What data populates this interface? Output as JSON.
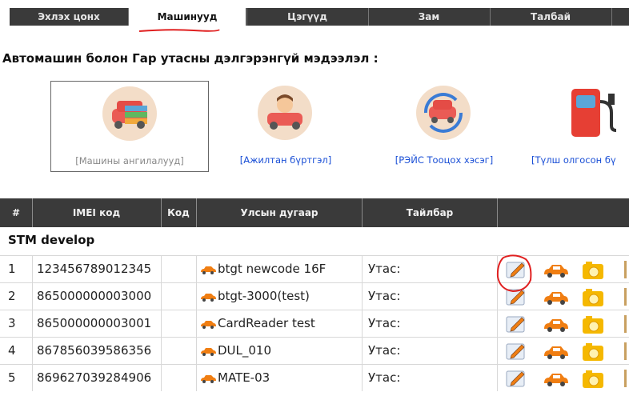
{
  "nav": {
    "tabs": [
      {
        "label": "Эхлэх цонх"
      },
      {
        "label": "Машинууд"
      },
      {
        "label": "Цэгүүд"
      },
      {
        "label": "Зам"
      },
      {
        "label": "Талбай"
      }
    ],
    "active_tab": "Машинууд"
  },
  "page": {
    "title": "Автомашин болон Гар утасны дэлгэрэнгүй мэдээлэл :"
  },
  "cards": [
    {
      "label": "[Машины ангилалууд]",
      "icon": "car-classes-icon"
    },
    {
      "label": "[Ажилтан бүртгэл]",
      "icon": "driver-icon"
    },
    {
      "label": "[РЭЙС Тооцох хэсэг]",
      "icon": "car-cycle-icon"
    },
    {
      "label": "[Түлш олгосон бү",
      "icon": "fuel-pump-icon"
    }
  ],
  "table": {
    "headers": [
      "#",
      "IMEI код",
      "Код",
      "Улсын дугаар",
      "Тайлбар",
      ""
    ],
    "group": "STM develop",
    "rows": [
      {
        "num": "1",
        "imei": "123456789012345",
        "code": "",
        "plate": "btgt newcode 16F",
        "note": "Утас:"
      },
      {
        "num": "2",
        "imei": "865000000003000",
        "code": "",
        "plate": "btgt-3000(test)",
        "note": "Утас:"
      },
      {
        "num": "3",
        "imei": "865000000003001",
        "code": "",
        "plate": "CardReader test",
        "note": "Утас:"
      },
      {
        "num": "4",
        "imei": "867856039586356",
        "code": "",
        "plate": "DUL_010",
        "note": "Утас:"
      },
      {
        "num": "5",
        "imei": "869627039284906",
        "code": "",
        "plate": "MATE-03",
        "note": "Утас:"
      }
    ]
  },
  "colors": {
    "header_bg": "#3a3a3a",
    "link": "#1a4fd6",
    "car_orange": "#f07e12",
    "camera_yellow": "#f5b800",
    "highlight_red": "#e02020"
  }
}
